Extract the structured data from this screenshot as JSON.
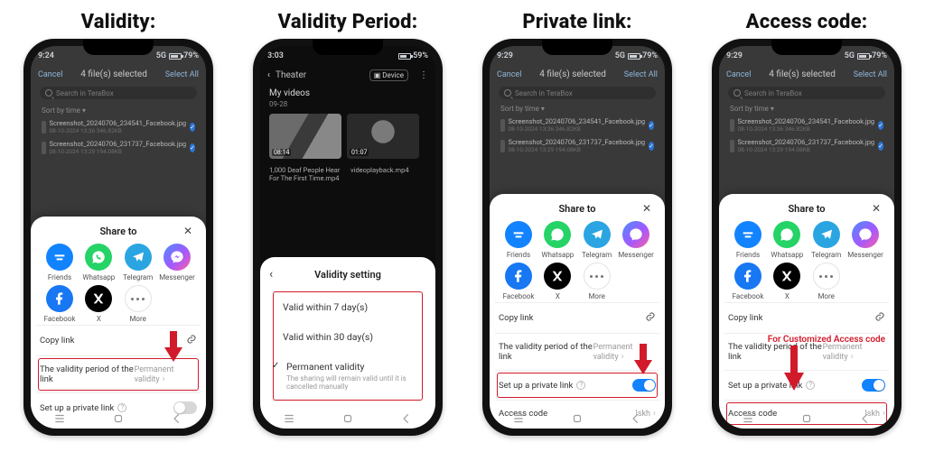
{
  "titles": [
    "Validity:",
    "Validity Period:",
    "Private link:",
    "Access code:"
  ],
  "status": {
    "timeA": "9:24",
    "timeB": "3:03",
    "timeC": "9:29",
    "battA": "79%",
    "battB": "59%",
    "netA": "5G"
  },
  "picker": {
    "cancel": "Cancel",
    "title": "4 file(s) selected",
    "selectAll": "Select All",
    "searchPlaceholder": "Search in TeraBox",
    "sort": "Sort by time",
    "row1": {
      "name": "Screenshot_20240706_234541_Facebook.jpg",
      "info": "08-10-2024  13:36   346.82KB"
    },
    "row2": {
      "name": "Screenshot_20240706_231737_Facebook.jpg",
      "info": "08-10-2024  13:29   194.08KB"
    }
  },
  "theater": {
    "title": "Theater",
    "tab": "Device",
    "section": "My videos",
    "date": "09-28",
    "dur1": "08:14",
    "dur2": "01:07",
    "cap1": "1,000 Deaf People Hear For The First Time.mp4",
    "cap2": "videoplayback.mp4"
  },
  "sheet": {
    "title": "Share to",
    "apps": {
      "friends": "Friends",
      "whatsapp": "Whatsapp",
      "telegram": "Telegram",
      "messenger": "Messenger",
      "facebook": "Facebook",
      "x": "X",
      "more": "More"
    },
    "copyLink": "Copy link",
    "validityLabel": "The validity period of the link",
    "validityValue": "Permanent validity",
    "privateLabel": "Set up a private link",
    "accessLabel": "Access code",
    "accessValue": "lskh"
  },
  "validity": {
    "panelTitle": "Validity setting",
    "opt1": "Valid within 7 day(s)",
    "opt2": "Valid within 30 day(s)",
    "opt3": "Permanent validity",
    "opt3sub": "The sharing will remain valid until it is cancelled manually"
  },
  "caption": {
    "accessNote": "For Customized Access code"
  }
}
